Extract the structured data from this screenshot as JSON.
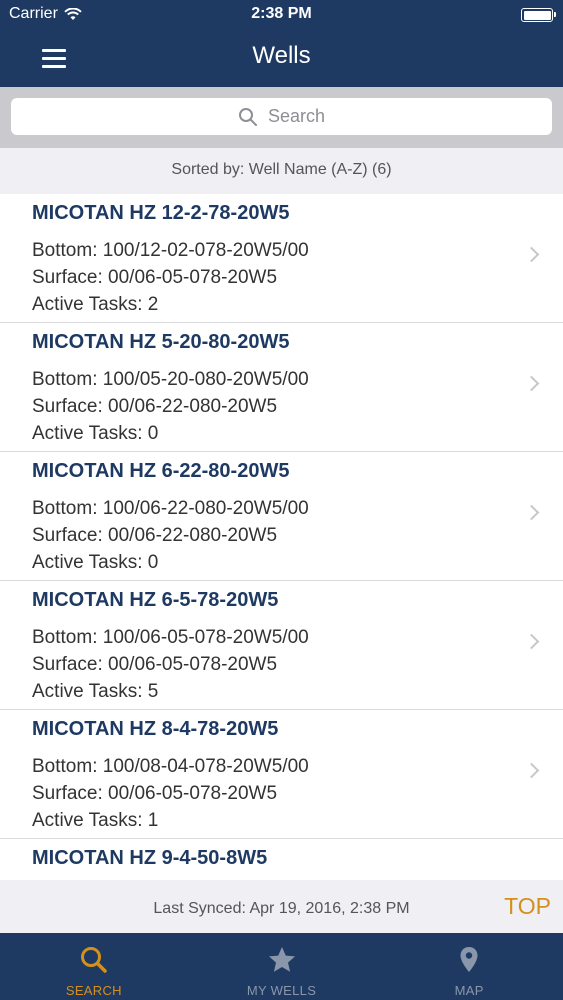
{
  "status": {
    "carrier": "Carrier",
    "time": "2:38 PM"
  },
  "nav": {
    "title": "Wells"
  },
  "search": {
    "placeholder": "Search"
  },
  "sort": {
    "label": "Sorted by: Well Name (A-Z) (6)"
  },
  "wells": [
    {
      "name": "MICOTAN HZ 12-2-78-20W5",
      "bottom": "Bottom: 100/12-02-078-20W5/00",
      "surface": "Surface: 00/06-05-078-20W5",
      "tasks": "Active Tasks: 2"
    },
    {
      "name": "MICOTAN HZ 5-20-80-20W5",
      "bottom": "Bottom: 100/05-20-080-20W5/00",
      "surface": "Surface: 00/06-22-080-20W5",
      "tasks": "Active Tasks: 0"
    },
    {
      "name": "MICOTAN HZ 6-22-80-20W5",
      "bottom": "Bottom: 100/06-22-080-20W5/00",
      "surface": "Surface: 00/06-22-080-20W5",
      "tasks": "Active Tasks: 0"
    },
    {
      "name": "MICOTAN HZ 6-5-78-20W5",
      "bottom": "Bottom: 100/06-05-078-20W5/00",
      "surface": "Surface: 00/06-05-078-20W5",
      "tasks": "Active Tasks: 5"
    },
    {
      "name": "MICOTAN HZ 8-4-78-20W5",
      "bottom": "Bottom: 100/08-04-078-20W5/00",
      "surface": "Surface: 00/06-05-078-20W5",
      "tasks": "Active Tasks: 1"
    },
    {
      "name": "MICOTAN HZ 9-4-50-8W5",
      "bottom": "",
      "surface": "",
      "tasks": ""
    }
  ],
  "footer": {
    "last_synced": "Last Synced: Apr 19, 2016, 2:38 PM",
    "top_label": "TOP"
  },
  "tabs": [
    {
      "label": "SEARCH",
      "icon": "search-icon",
      "active": true
    },
    {
      "label": "MY WELLS",
      "icon": "star-icon",
      "active": false
    },
    {
      "label": "MAP",
      "icon": "map-pin-icon",
      "active": false
    }
  ],
  "colors": {
    "brand": "#1e3a63",
    "accent": "#d4901c",
    "tab_inactive": "#8a96aa"
  }
}
